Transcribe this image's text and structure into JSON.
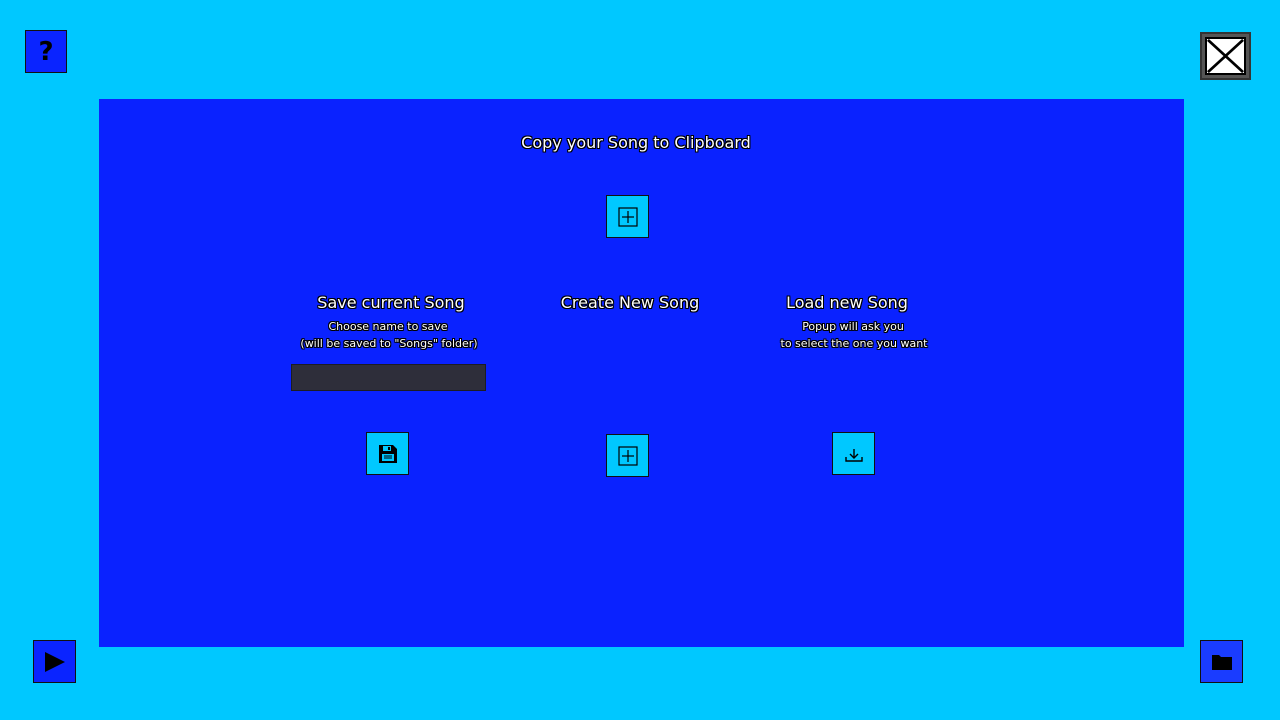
{
  "corner_buttons": {
    "help_label": "?"
  },
  "panel": {
    "clipboard": {
      "title": "Copy your Song to Clipboard"
    },
    "save": {
      "title": "Save current Song",
      "subtitle_line1": "Choose name to save",
      "subtitle_line2": "(will be saved to \"Songs\" folder)",
      "name_input_value": ""
    },
    "create": {
      "title": "Create New Song"
    },
    "load": {
      "title": "Load new Song",
      "subtitle_line1": "Popup will ask you",
      "subtitle_line2": "to select the one you want"
    }
  },
  "icons": {
    "help": "question-mark-icon",
    "close": "close-x-icon",
    "copy": "plus-square-icon",
    "save": "floppy-disk-icon",
    "create": "plus-square-icon",
    "load": "download-icon",
    "play": "play-icon",
    "folder": "folder-icon"
  },
  "colors": {
    "background": "#00c8ff",
    "panel": "#0a22ff",
    "button_fill": "#00c8ff",
    "input_fill": "#2e2e3a"
  }
}
